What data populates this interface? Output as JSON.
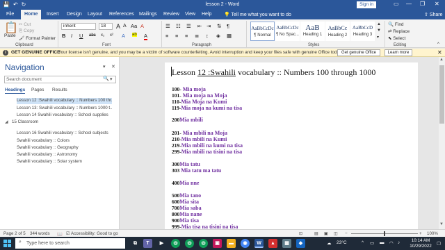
{
  "window": {
    "title": "lesson 2  -  Word",
    "sign_in": "Sign in",
    "minimize": "—",
    "restore": "❐",
    "close": "✕"
  },
  "qat": {
    "save": "💾",
    "undo": "↶",
    "redo": "↻"
  },
  "tabs": [
    "File",
    "Home",
    "Insert",
    "Design",
    "Layout",
    "References",
    "Mailings",
    "Review",
    "View",
    "Help"
  ],
  "active_tab": "Home",
  "tell_me": "Tell me what you want to do",
  "share": "Share",
  "ribbon": {
    "clipboard": {
      "paste": "Paste",
      "cut": "Cut",
      "copy": "Copy",
      "format_painter": "Format Painter",
      "label": "Clipboard"
    },
    "font": {
      "name": "inherit",
      "size": "18",
      "label": "Font",
      "grow": "A",
      "shrink": "A",
      "case": "Aa",
      "clear": "A",
      "bold": "B",
      "italic": "I",
      "underline": "U",
      "strike": "abc",
      "sub": "x₂",
      "sup": "x²",
      "effects": "A",
      "highlight": "ab",
      "color": "A"
    },
    "paragraph": {
      "label": "Paragraph"
    },
    "styles": {
      "label": "Styles",
      "items": [
        {
          "sample": "AaBbCcDc",
          "name": "¶ Normal"
        },
        {
          "sample": "AaBbCcDc",
          "name": "¶ No Spac..."
        },
        {
          "sample": "AaB",
          "name": "Heading 1"
        },
        {
          "sample": "AaBbCc",
          "name": "Heading 2"
        },
        {
          "sample": "AaBbCcD",
          "name": "Heading 3"
        }
      ]
    },
    "editing": {
      "find": "Find",
      "replace": "Replace",
      "select": "Select",
      "label": "Editing"
    }
  },
  "genuine": {
    "title": "GET GENUINE OFFICE",
    "message": "Your license isn't genuine, and you may be a victim of software counterfeiting. Avoid interruption and keep your files safe with genuine Office today.",
    "button": "Get genuine Office",
    "learn": "Learn more",
    "close": "✕"
  },
  "navigation": {
    "title": "Navigation",
    "search_placeholder": "Search document",
    "tabs": [
      "Headings",
      "Pages",
      "Results"
    ],
    "items": [
      "Lesson 12 :Swahili vocabulary :: Numbers 100 thr...",
      "Lesson 13: Swahili vocabulary :: Numbers 1000 t...",
      "Lesson 14 Swahili vocabulary :: School supplies",
      "15 Classroom",
      "Lesson 16 Swahili vocabulary :: School subjects",
      "Swahili vocabulary :: Colors",
      "Swahili vocabulary :: Geography",
      "Swahili vocabulary :: Astronomy",
      "Swahili vocabulary :: Solar system"
    ]
  },
  "document": {
    "heading_prefix": "Lesson ",
    "heading_ul": "12 :Swahili",
    "heading_suffix": " vocabulary :: Numbers 100 through 1000",
    "lines": [
      {
        "num": "100-",
        "text": " Mia moja"
      },
      {
        "num": "101-",
        "text": " Mia moja na Moja"
      },
      {
        "num": "110-",
        "text": "Mia Moja na Kumi"
      },
      {
        "num": "119-",
        "text": "Mia moja na kumi na tisa"
      },
      {
        "num": "200",
        "text": "Mia mbili"
      },
      {
        "num": "201-",
        "text": " Mia mbili na Moja"
      },
      {
        "num": "210-",
        "text": "Mia mbili na Kumi"
      },
      {
        "num": "219-",
        "text": "Mia mbili na kumi na tisa"
      },
      {
        "num": "299-",
        "text": "Mia mbili na tisini na tisa"
      },
      {
        "num": "300",
        "text": "Mia tatu"
      },
      {
        "num": "303",
        "text": " Mia tatu ma tatu"
      },
      {
        "num": "400",
        "text": "Mia nne"
      },
      {
        "num": "500",
        "text": "Mia tano"
      },
      {
        "num": "600",
        "text": "Mia sita"
      },
      {
        "num": "700",
        "text": "Mia saba"
      },
      {
        "num": "800",
        "text": "Mia nane"
      },
      {
        "num": "900",
        "text": "Mia tisa"
      },
      {
        "num": "999-",
        "text": "Mia tisa na tisini na tisa"
      }
    ]
  },
  "status": {
    "page": "Page 2 of 5",
    "words": "344 words",
    "accessibility": "Accessibility: Good to go",
    "zoom": "100%"
  },
  "taskbar": {
    "search_placeholder": "Type here to search",
    "weather": "23°C",
    "time": "10:14 AM",
    "date": "10/29/2022"
  }
}
